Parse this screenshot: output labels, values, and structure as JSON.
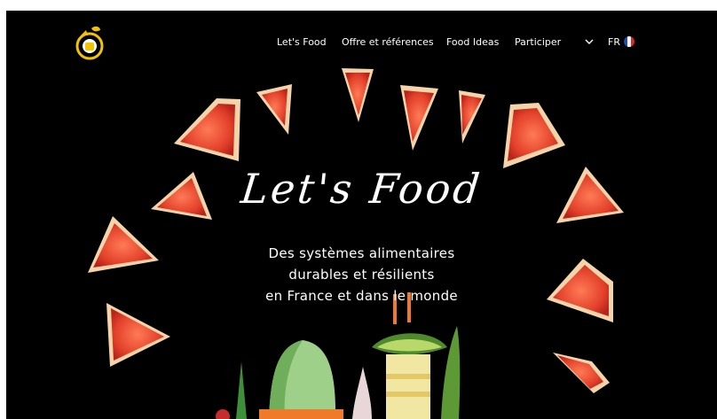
{
  "header": {
    "nav": [
      {
        "label": "Let's Food"
      },
      {
        "label": "Offre et références"
      },
      {
        "label": "Food Ideas"
      },
      {
        "label": "Participer"
      }
    ],
    "language": "FR",
    "icons": {
      "logo": "lets-food-logo",
      "dropdown": "chevron-down-icon",
      "flag": "flag-france-icon"
    }
  },
  "hero": {
    "title": "Let's Food",
    "subtitle_lines": [
      "Des systèmes alimentaires",
      "durables et résilients",
      "en France et dans le monde"
    ]
  },
  "colors": {
    "background": "#000000",
    "accent": "#f2c300",
    "grapefruit": "#e2402a",
    "rind": "#f4d4a8"
  }
}
